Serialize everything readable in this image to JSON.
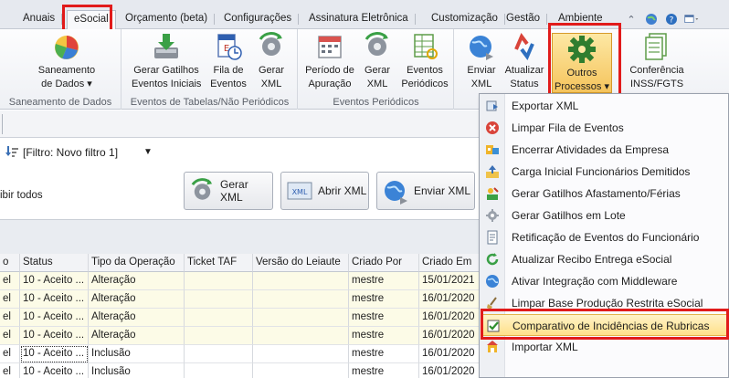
{
  "tabs": [
    "Anuais",
    "eSocial",
    "Orçamento (beta)",
    "Configurações",
    "Assinatura Eletrônica",
    "Customização",
    "Gestão",
    "Ambiente"
  ],
  "active_tab": "eSocial",
  "ribbon": {
    "groups": {
      "saneamento": "Saneamento de Dados",
      "tabelas": "Eventos de Tabelas/Não Periódicos",
      "periodicos": "Eventos Periódicos"
    },
    "buttons": {
      "saneamento_l1": "Saneamento",
      "saneamento_l2": "de Dados ▾",
      "gatilhos_l1": "Gerar Gatilhos",
      "gatilhos_l2": "Eventos Iniciais",
      "fila_l1": "Fila de",
      "fila_l2": "Eventos",
      "gerarxml1_l1": "Gerar",
      "gerarxml1_l2": "XML",
      "periodo_l1": "Período de",
      "periodo_l2": "Apuração",
      "gerarxml2_l1": "Gerar",
      "gerarxml2_l2": "XML",
      "eventosper_l1": "Eventos",
      "eventosper_l2": "Periódicos",
      "enviar_l1": "Enviar",
      "enviar_l2": "XML",
      "atualizar_l1": "Atualizar",
      "atualizar_l2": "Status",
      "outros_l1": "Outros",
      "outros_l2": "Processos ▾",
      "conferencia_l1": "Conferência",
      "conferencia_l2": "INSS/FGTS"
    }
  },
  "filter": {
    "label": "[Filtro: Novo filtro 1]"
  },
  "exibir_label": "ibir todos",
  "actions": {
    "gerar_xml": "Gerar XML",
    "abrir_xml": "Abrir XML",
    "enviar_xml": "Enviar XML",
    "xml_badge": "XML"
  },
  "grid": {
    "columns": [
      "o",
      "Status",
      "Tipo da Operação",
      "Ticket TAF",
      "Versão do Leiaute",
      "Criado Por",
      "Criado Em"
    ],
    "rows": [
      [
        "el",
        "10 - Aceito ...",
        "Alteração",
        "",
        "",
        "mestre",
        "15/01/2021"
      ],
      [
        "el",
        "10 - Aceito ...",
        "Alteração",
        "",
        "",
        "mestre",
        "16/01/2020"
      ],
      [
        "el",
        "10 - Aceito ...",
        "Alteração",
        "",
        "",
        "mestre",
        "16/01/2020"
      ],
      [
        "el",
        "10 - Aceito ...",
        "Alteração",
        "",
        "",
        "mestre",
        "16/01/2020"
      ],
      [
        "el",
        "10 - Aceito ...",
        "Inclusão",
        "",
        "",
        "mestre",
        "16/01/2020"
      ],
      [
        "el",
        "10 - Aceito ...",
        "Inclusão",
        "",
        "",
        "mestre",
        "16/01/2020"
      ]
    ]
  },
  "menu": {
    "items": [
      "Exportar XML",
      "Limpar Fila de Eventos",
      "Encerrar Atividades da Empresa",
      "Carga Inicial Funcionários Demitidos",
      "Gerar Gatilhos Afastamento/Férias",
      "Gerar Gatilhos em Lote",
      "Retificação de Eventos do Funcionário",
      "Atualizar Recibo Entrega eSocial",
      "Ativar Integração com Middleware",
      "Limpar Base Produção Restrita eSocial",
      "Comparativo de Incidências de Rubricas",
      "Importar XML"
    ],
    "highlighted_index": 10
  },
  "colors": {
    "highlight": "#e11b1b",
    "pressed": "#f5c45c",
    "hover": "#ffe08a",
    "row_alt": "#fcfbe7"
  }
}
